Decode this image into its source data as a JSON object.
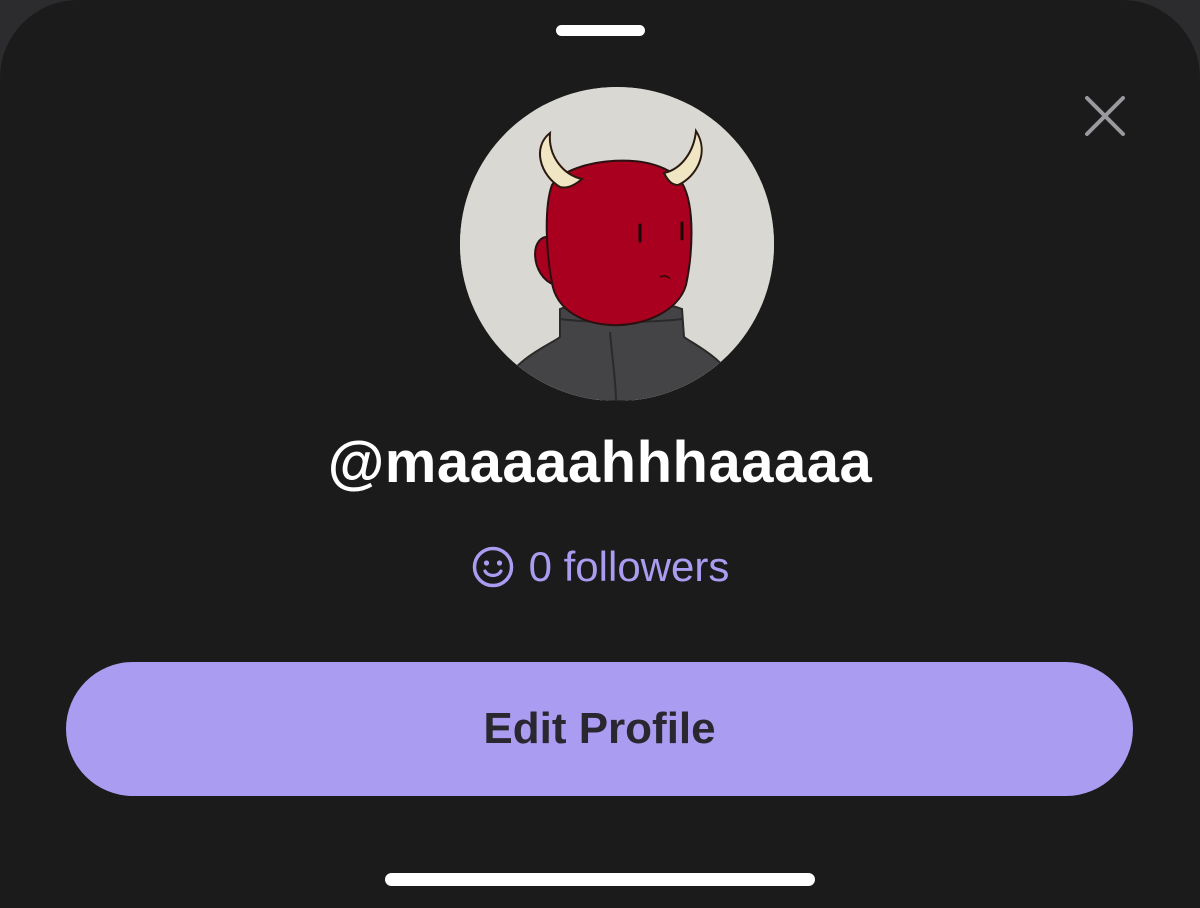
{
  "profile": {
    "username": "@maaaaahhhaaaaa",
    "followers_text": "0 followers",
    "followers_icon": "smile-icon",
    "avatar_description_icon": "devil-avatar"
  },
  "actions": {
    "edit_profile_label": "Edit Profile",
    "close_icon": "close-icon"
  },
  "colors": {
    "sheet_background": "#1b1b1c",
    "accent": "#aa9cf0",
    "button_text": "#2a2730",
    "text_primary": "#ffffff",
    "close_icon": "#9a9a9e"
  }
}
